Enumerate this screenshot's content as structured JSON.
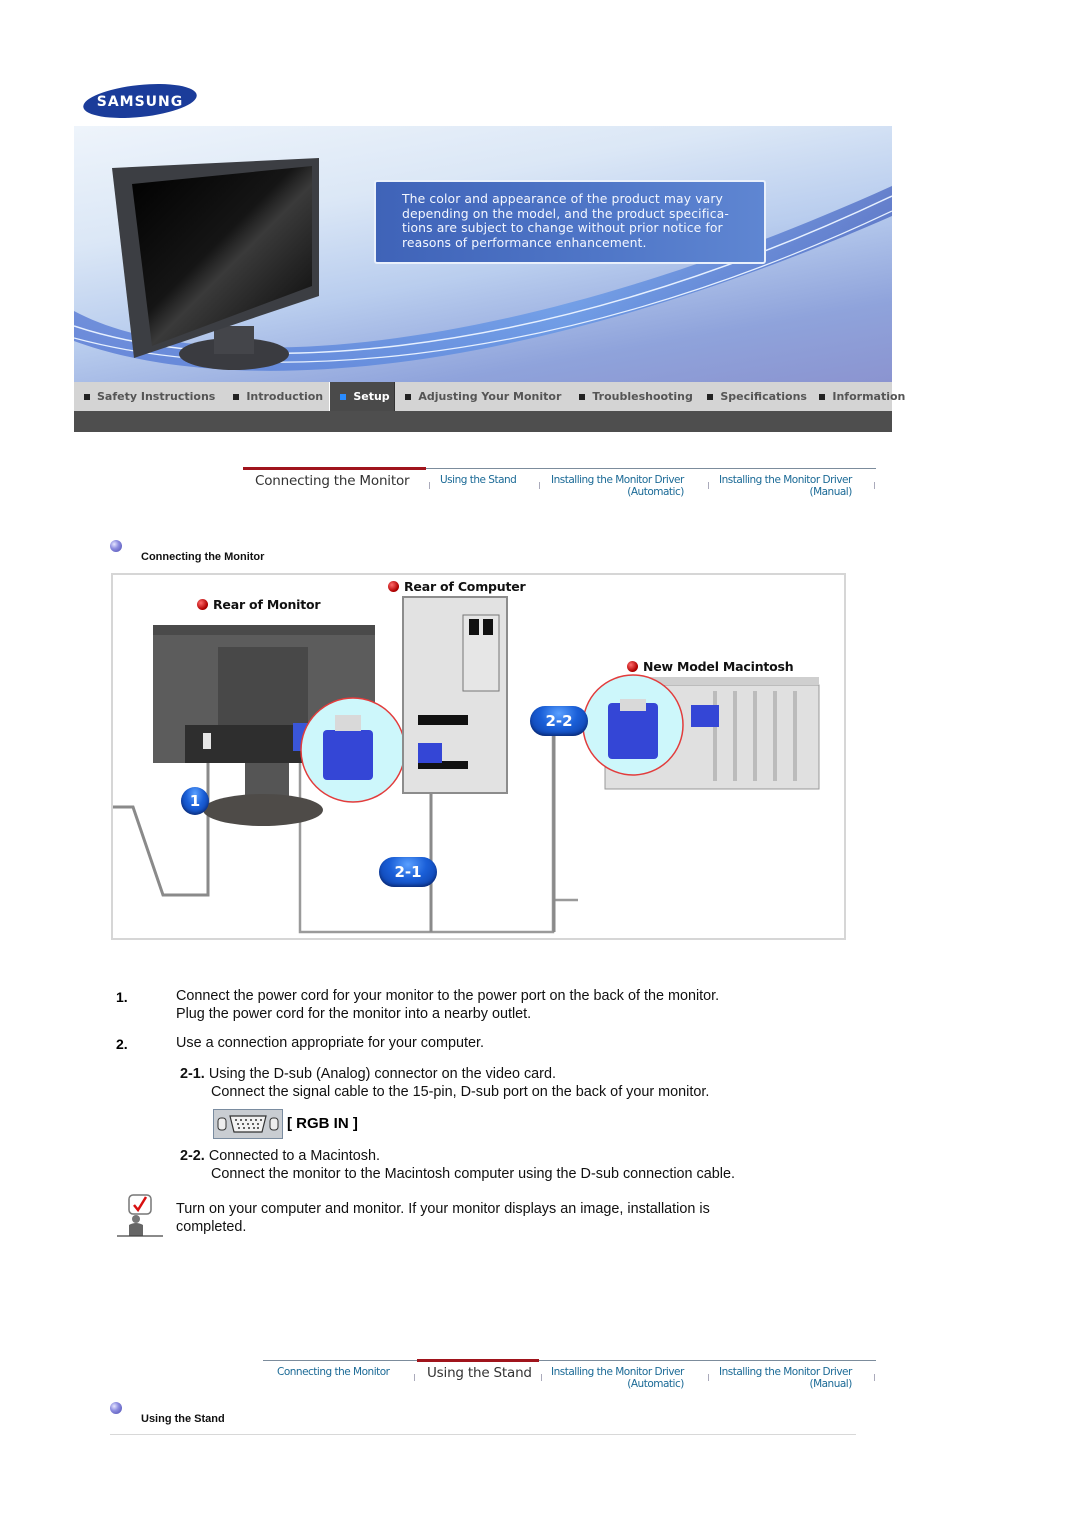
{
  "brand": {
    "logo_text": "SAMSUNG",
    "logo_color": "#1b3c9a"
  },
  "banner": {
    "notice_lines": [
      "The color and appearance of the product may vary",
      "depending on the model, and the product specifica-",
      "tions are subject to change without prior notice for",
      "reasons of performance enhancement."
    ]
  },
  "main_nav": {
    "items": [
      {
        "label": "Safety Instructions",
        "active": false
      },
      {
        "label": "Introduction",
        "active": false
      },
      {
        "label": "Setup",
        "active": true
      },
      {
        "label": "Adjusting Your Monitor",
        "active": false
      },
      {
        "label": "Troubleshooting",
        "active": false
      },
      {
        "label": "Specifications",
        "active": false
      },
      {
        "label": "Information",
        "active": false
      }
    ]
  },
  "sub_nav_top": {
    "items": [
      {
        "label": "Connecting the Monitor",
        "line2": "",
        "current": true
      },
      {
        "label": "Using the Stand",
        "line2": "",
        "current": false
      },
      {
        "label": "Installing the Monitor Driver",
        "line2": "(Automatic)",
        "current": false
      },
      {
        "label": "Installing the Monitor Driver",
        "line2": "(Manual)",
        "current": false
      }
    ]
  },
  "section1": {
    "title": "Connecting the Monitor"
  },
  "diagram": {
    "labels": {
      "rear_monitor": "Rear of Monitor",
      "rear_computer": "Rear of Computer",
      "mac": "New Model Macintosh"
    },
    "badges": {
      "one": "1",
      "two_one": "2-1",
      "two_two": "2-2"
    }
  },
  "steps": [
    {
      "num": "1.",
      "lines": [
        "Connect the power cord for your monitor to the power port on the back of the monitor.",
        "Plug the power cord for the monitor into a nearby outlet."
      ]
    },
    {
      "num": "2.",
      "lines": [
        "Use a connection appropriate for your computer."
      ],
      "substeps": [
        {
          "num": "2-1.",
          "title": "Using the D-sub (Analog) connector on the video card.",
          "detail": "Connect the signal cable to the 15-pin, D-sub port on the back of your monitor.",
          "port_label": "[ RGB IN ]"
        },
        {
          "num": "2-2.",
          "title": "Connected to a Macintosh.",
          "detail": "Connect the monitor to the Macintosh computer using the D-sub connection cable."
        }
      ]
    }
  ],
  "note": {
    "lines": [
      "Turn on your computer and monitor. If your monitor displays an image, installation is",
      "completed."
    ]
  },
  "sub_nav_bottom": {
    "items": [
      {
        "label": "Connecting  the Monitor",
        "line2": "",
        "current": false
      },
      {
        "label": "Using the Stand",
        "line2": "",
        "current": true
      },
      {
        "label": "Installing the Monitor Driver",
        "line2": "(Automatic)",
        "current": false
      },
      {
        "label": "Installing the Monitor Driver",
        "line2": "(Manual)",
        "current": false
      }
    ]
  },
  "section2": {
    "title": "Using the Stand"
  }
}
